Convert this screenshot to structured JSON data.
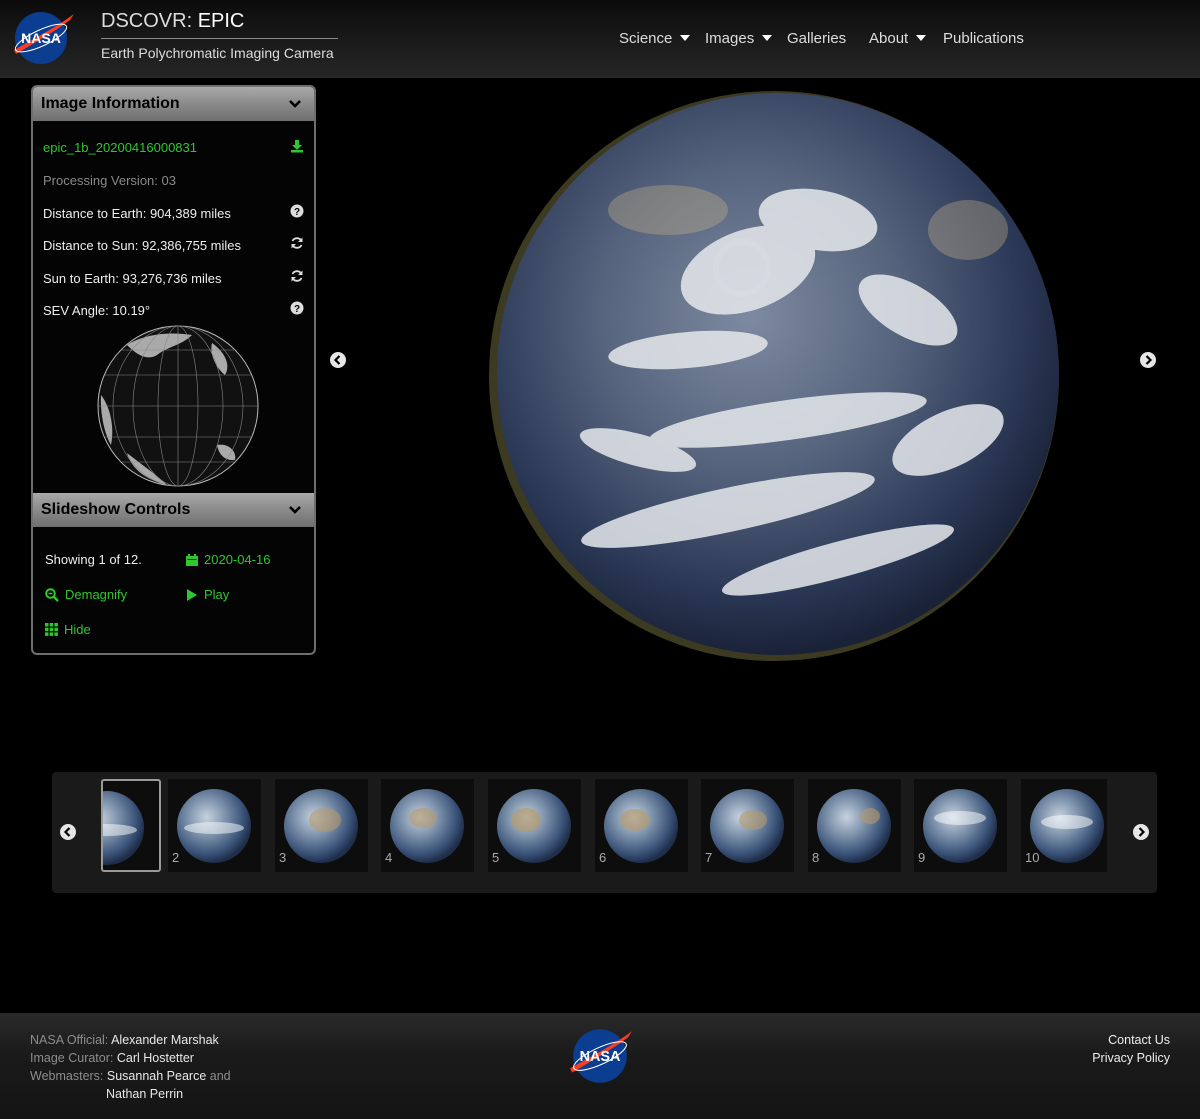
{
  "header": {
    "title_prefix": "DSCOVR:",
    "title_main": "EPIC",
    "subtitle": "Earth Polychromatic Imaging Camera",
    "logo_text": "NASA",
    "nav": [
      {
        "label": "Science",
        "dropdown": true
      },
      {
        "label": "Images",
        "dropdown": true
      },
      {
        "label": "Galleries",
        "dropdown": false
      },
      {
        "label": "About",
        "dropdown": true
      },
      {
        "label": "Publications",
        "dropdown": false
      }
    ]
  },
  "image_info": {
    "heading": "Image Information",
    "filename": "epic_1b_20200416000831",
    "processing_version": "Processing Version: 03",
    "distance_earth": "Distance to Earth: 904,389 miles",
    "distance_sun": "Distance to Sun: 92,386,755 miles",
    "sun_to_earth": "Sun to Earth: 93,276,736 miles",
    "sev_angle": "SEV Angle: 10.19°"
  },
  "slideshow": {
    "heading": "Slideshow Controls",
    "showing": "Showing 1 of 12.",
    "date": "2020-04-16",
    "demagnify": "Demagnify",
    "play": "Play",
    "hide": "Hide"
  },
  "thumbnails": [
    "",
    "2",
    "3",
    "4",
    "5",
    "6",
    "7",
    "8",
    "9",
    "10"
  ],
  "footer": {
    "official_label": "NASA Official:",
    "official_name": "Alexander Marshak",
    "curator_label": "Image Curator:",
    "curator_name": "Carl Hostetter",
    "webmasters_label": "Webmasters:",
    "webmaster_1": "Susannah Pearce",
    "and": "and",
    "webmaster_2": "Nathan Perrin",
    "contact": "Contact Us",
    "privacy": "Privacy Policy"
  },
  "colors": {
    "accent_green": "#2ec82e",
    "nasa_blue": "#0b3d91",
    "nasa_red": "#fc3d21"
  },
  "icons": [
    "nasa-logo",
    "caret-down-icon",
    "chevron-down-icon",
    "download-icon",
    "help-icon",
    "refresh-icon",
    "calendar-icon",
    "zoom-out-icon",
    "play-icon",
    "grid-icon",
    "arrow-left-icon",
    "arrow-right-icon"
  ]
}
